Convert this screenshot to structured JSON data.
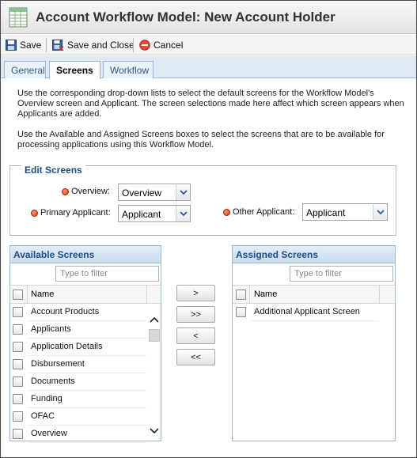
{
  "window": {
    "title": "Account Workflow Model: New Account Holder"
  },
  "toolbar": {
    "save": "Save",
    "save_close": "Save and Close",
    "cancel": "Cancel"
  },
  "tabs": [
    {
      "label": "General",
      "active": false
    },
    {
      "label": "Screens",
      "active": true
    },
    {
      "label": "Workflow",
      "active": false
    }
  ],
  "intro": {
    "p1": "Use the corresponding drop-down lists to select the default screens for the Workflow Model's Overview screen and Applicant. The screen selections made here affect which screen appears when Applicants are added.",
    "p2": "Use the Available and Assigned Screens boxes to select the screens that are to be available for processing applications using this Workflow Model."
  },
  "edit_screens": {
    "legend": "Edit Screens",
    "overview": {
      "label": "Overview:",
      "value": "Overview"
    },
    "primary": {
      "label": "Primary Applicant:",
      "value": "Applicant"
    },
    "other": {
      "label": "Other Applicant:",
      "value": "Applicant"
    }
  },
  "available": {
    "title": "Available Screens",
    "filter_placeholder": "Type to filter",
    "column": "Name",
    "rows": [
      "Account Products",
      "Applicants",
      "Application Details",
      "Disbursement",
      "Documents",
      "Funding",
      "OFAC",
      "Overview"
    ]
  },
  "assigned": {
    "title": "Assigned Screens",
    "filter_placeholder": "Type to filter",
    "column": "Name",
    "rows": [
      "Additional Applicant Screen"
    ]
  },
  "move_buttons": {
    "add": ">",
    "add_all": ">>",
    "remove": "<",
    "remove_all": "<<"
  },
  "colors": {
    "accent": "#1f4e86",
    "tab_bg": "#dde9f5",
    "required": "#d23a10"
  }
}
